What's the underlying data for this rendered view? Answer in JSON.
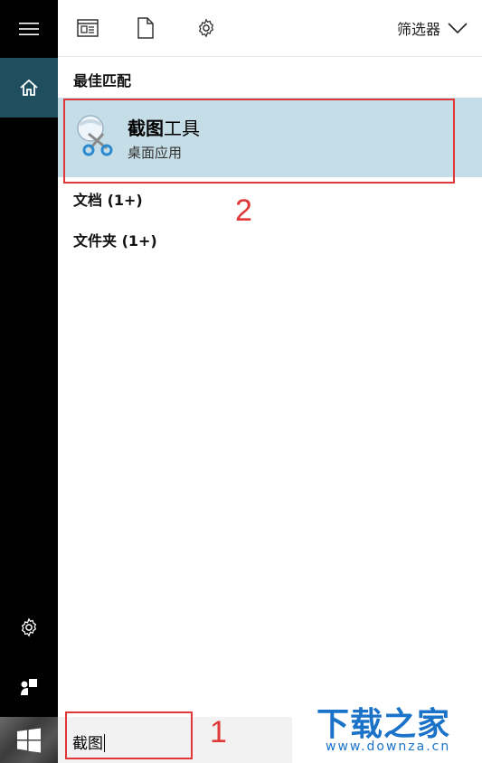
{
  "toolbar": {
    "filter_label": "筛选器"
  },
  "best_match": {
    "header": "最佳匹配",
    "title_bold": "截图",
    "title_rest": "工具",
    "subtitle": "桌面应用"
  },
  "categories": [
    {
      "label": "文档 (1+)"
    },
    {
      "label": "文件夹 (1+)"
    }
  ],
  "search": {
    "value": "截图"
  },
  "annotations": {
    "step1": "1",
    "step2": "2"
  },
  "watermark": {
    "title": "下载之家",
    "url": "www.downza.cn"
  },
  "icons": {
    "hamburger": "hamburger-icon",
    "home": "home-icon",
    "apps": "apps-icon",
    "documents": "document-icon",
    "settings": "gear-icon",
    "user": "user-icon",
    "start": "windows-logo-icon",
    "filter": "chevron-down-icon",
    "snipping_tool": "snipping-tool-icon"
  },
  "colors": {
    "rail": "#000000",
    "home_active": "#1f4e5f",
    "result_bg": "#c5dde6",
    "annotation_red": "#e03838",
    "watermark_blue": "#1a73c8"
  }
}
